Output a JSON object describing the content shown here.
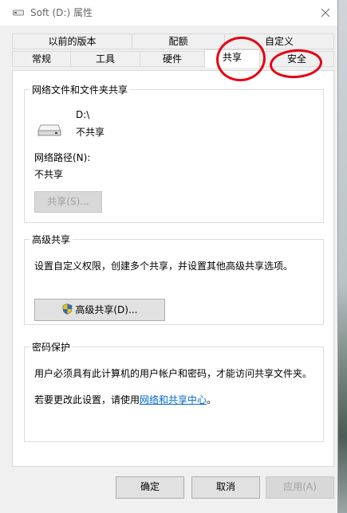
{
  "window": {
    "title": "Soft (D:) 属性"
  },
  "tabs": {
    "row_top": [
      "以前的版本",
      "配额",
      "自定义"
    ],
    "row_bottom": [
      "常规",
      "工具",
      "硬件",
      "共享",
      "安全"
    ],
    "active": "共享"
  },
  "network_sharing": {
    "legend": "网络文件和文件夹共享",
    "drive_name": "D:\\",
    "drive_status": "不共享",
    "network_path_label": "网络路径(N):",
    "network_path_value": "不共享",
    "share_button": "共享(S)..."
  },
  "advanced_sharing": {
    "legend": "高级共享",
    "description": "设置自定义权限，创建多个共享，并设置其他高级共享选项。",
    "button": "高级共享(D)..."
  },
  "password_protection": {
    "legend": "密码保护",
    "description": "用户必须具有此计算机的用户帐户和密码，才能访问共享文件夹。",
    "change_prefix": "若要更改此设置，请使用",
    "link": "网络和共享中心",
    "change_suffix": "。"
  },
  "footer": {
    "ok": "确定",
    "cancel": "取消",
    "apply": "应用(A)"
  },
  "colors": {
    "annotation": "#e60012",
    "link": "#0066cc"
  }
}
